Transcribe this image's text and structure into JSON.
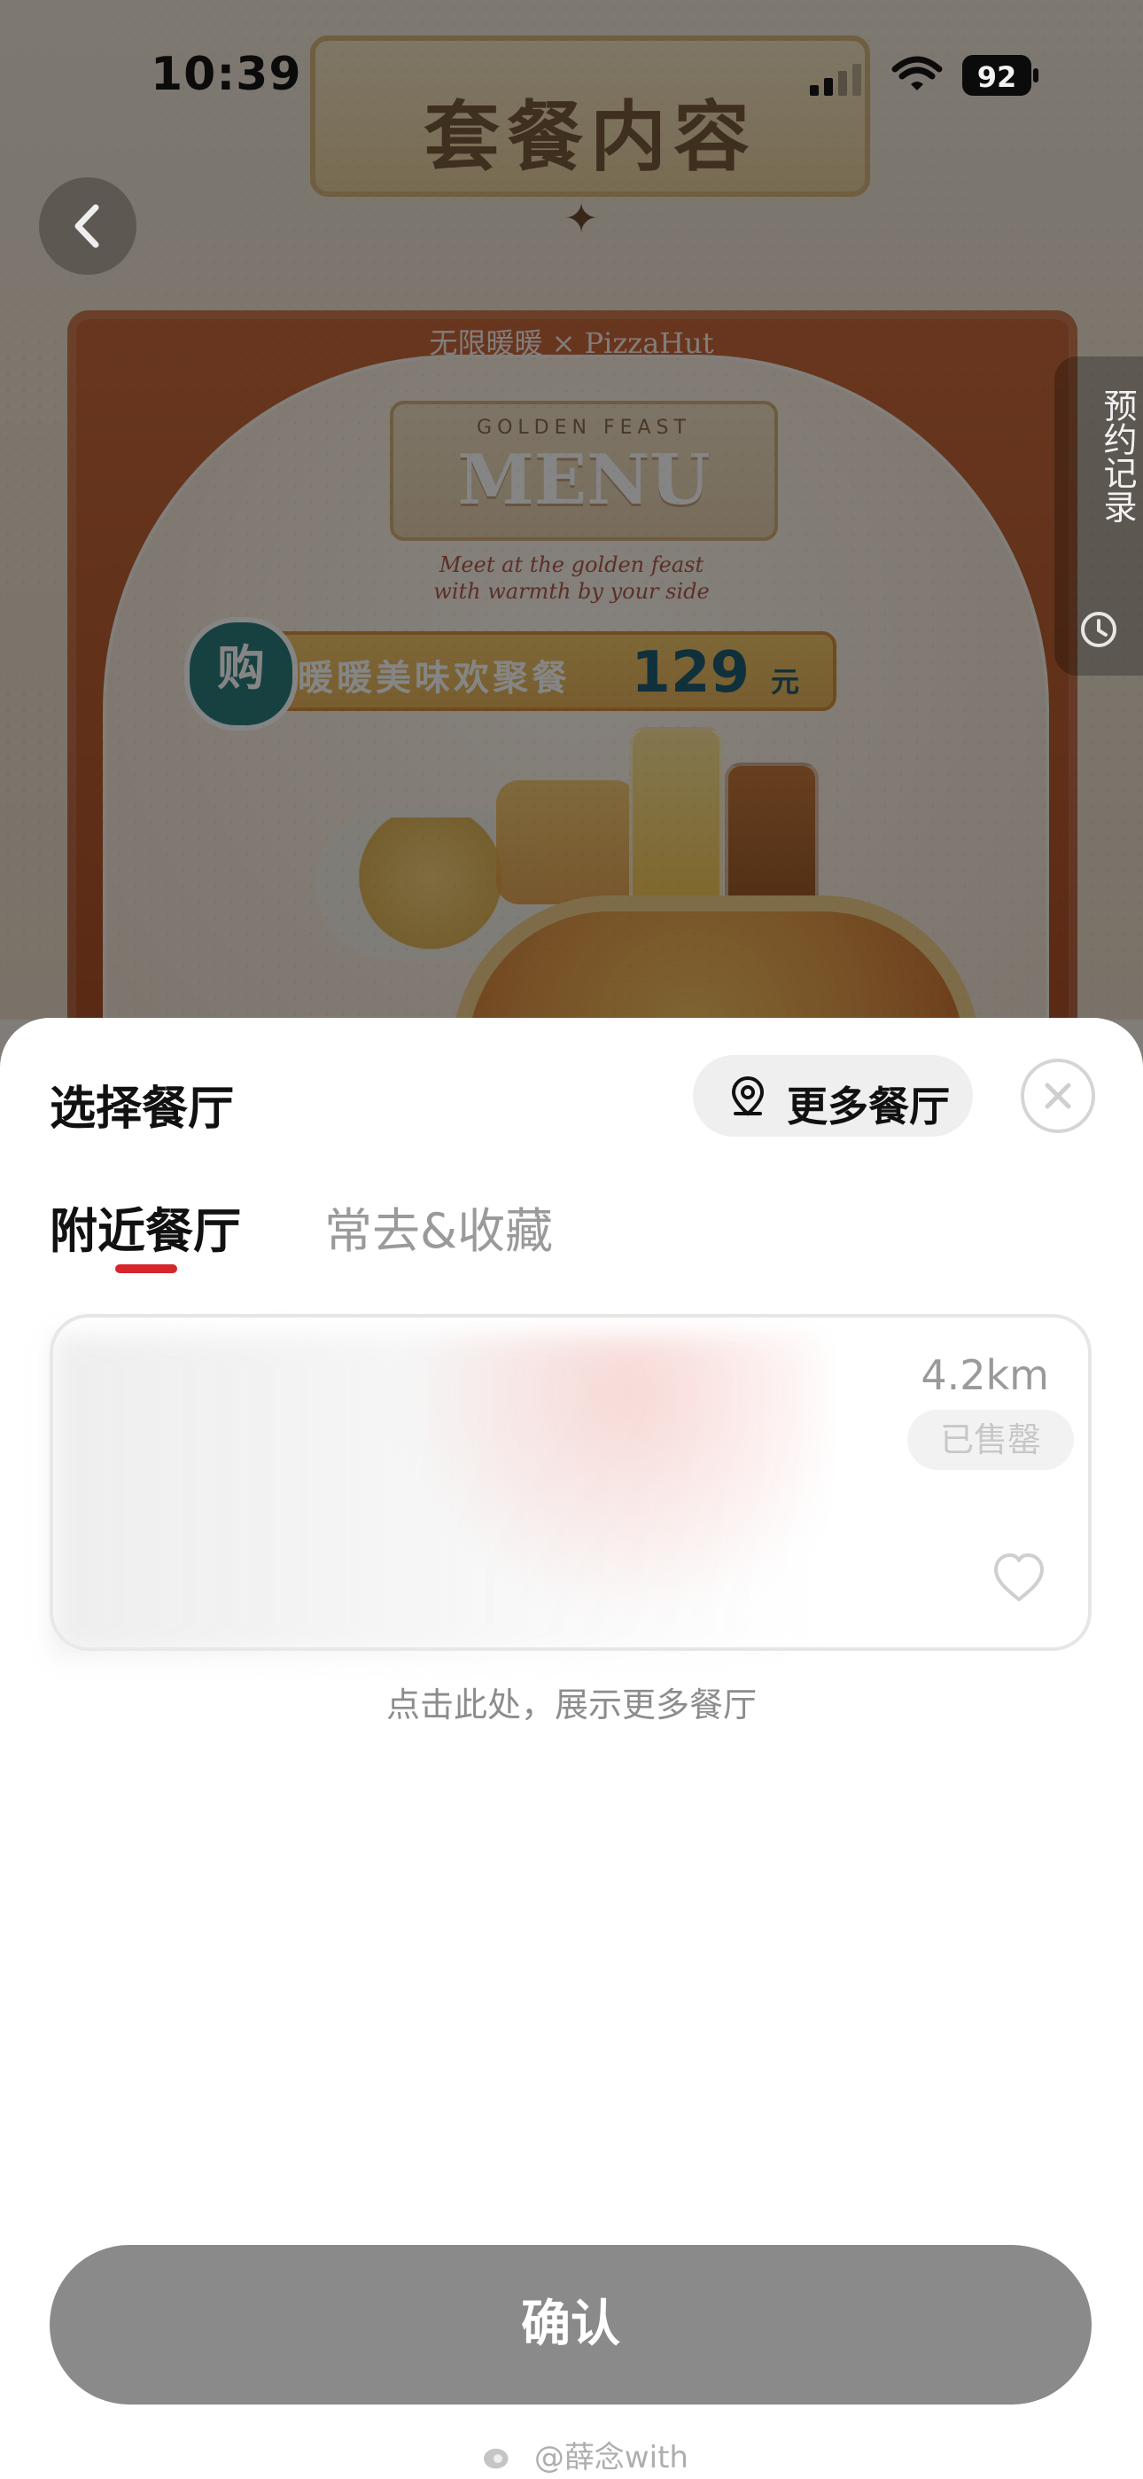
{
  "status_bar": {
    "time": "10:39",
    "battery": "92"
  },
  "background_promo": {
    "ribbon_title": "套餐内容",
    "brand_line": "无限暖暖 × PizzaHut",
    "menu_sign_top": "GOLDEN FEAST",
    "menu_sign": "MENU",
    "script_line1": "Meet at the golden feast",
    "script_line2": "with warmth by your side",
    "badge": "购",
    "banner_text": "暖暖美味欢聚餐",
    "price": "129",
    "price_unit": "元"
  },
  "side_tab": {
    "label": "预约记录"
  },
  "sheet": {
    "title": "选择餐厅",
    "more_button_label": "更多餐厅",
    "tabs": [
      {
        "label": "附近餐厅",
        "active": true
      },
      {
        "label": "常去&收藏",
        "active": false
      }
    ],
    "restaurant_card": {
      "distance": "4.2km",
      "status_badge": "已售罄"
    },
    "show_more_text": "点击此处，展示更多餐厅",
    "confirm_label": "确认"
  },
  "watermark": {
    "text": "@薛念with"
  },
  "colors": {
    "accent_red": "#d7262b",
    "confirm_bg": "#8a8a8a",
    "chip_bg": "#efefef"
  },
  "icons": {
    "back": "chevron-left-icon",
    "close": "close-icon",
    "more_restaurants": "location-pin-icon",
    "favorite": "heart-icon",
    "history_clock": "clock-icon",
    "watermark_logo": "weibo-icon",
    "signal": "signal-icon",
    "wifi": "wifi-icon",
    "battery": "battery-icon"
  }
}
